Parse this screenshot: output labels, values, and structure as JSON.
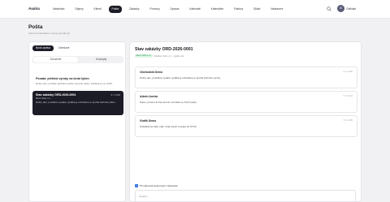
{
  "app": {
    "logo": "Auxira"
  },
  "nav": {
    "items": [
      {
        "label": "Nástěnka",
        "active": false
      },
      {
        "label": "Objevy",
        "active": false
      },
      {
        "label": "Klienti",
        "active": false
      },
      {
        "label": "Pošta",
        "active": true
      },
      {
        "label": "Zákazky",
        "active": false
      },
      {
        "label": "Pomocy",
        "active": false
      },
      {
        "label": "Úprava",
        "active": false
      },
      {
        "label": "Kalendář",
        "active": false
      },
      {
        "label": "Kalendáře",
        "active": false
      },
      {
        "label": "Faktury",
        "active": false
      },
      {
        "label": "Sklad",
        "active": false
      },
      {
        "label": "Nastavení",
        "active": false
      }
    ],
    "user_initials": "O",
    "user_name": "Odhlásit"
  },
  "page": {
    "title": "Pošta",
    "subtitle": "Interní komunikace a týmy pro klienty"
  },
  "left_panel": {
    "new_button": "Nová zpráva",
    "secondary_button": "Odeslané",
    "segments": [
      {
        "label": "Doručené",
        "active": true
      },
      {
        "label": "Koncepty",
        "active": false
      }
    ],
    "threads": [
      {
        "title": "Porada: přehled výroby na tento týden",
        "text": "Dobrý den, posílám přehled výroby na tento týden, začátek je ve 14:00.",
        "meta": "",
        "time": "",
        "selected": false
      },
      {
        "title": "Stav zakázky ORD-2026-0001",
        "meta": "Klient: Nefin s.r.o.",
        "text": "Dobrý den, posíláme update: grafika je schválena a výroba běží dle plánu.",
        "time": "8. 3. 10:00",
        "selected": true
      }
    ]
  },
  "right_panel": {
    "title": "Stav zakázky ORD-2026-0001",
    "chip": "Klient: Nefin s.r.o.",
    "meta": "Zakázka: Nefin s.r.o. – grafika, tisk",
    "messages": [
      {
        "author": "Obchodník Demo",
        "text": "Dobrý den, posíláme update: grafika je schválena a výroba běží dle výroby.",
        "time": "8. 3. 10:00"
      },
      {
        "author": "Admin Auxira",
        "text": "Super, prosím & time termín montáže ve zbozí tyden.",
        "time": "8. 3. 10:14"
      },
      {
        "author": "Grafik Demo",
        "text": "Podklady ke tisku nahr. final export a kopie do 15:00.",
        "time": "8. 3. 11:05"
      }
    ],
    "composer_check": "Při odpovědi poslat kopii i zadavateli",
    "composer_placeholder": "Napište..."
  },
  "colors": {
    "accent_dark": "#1c1c26",
    "chip_green": "#1f8a45",
    "checkbox_blue": "#2f6de1"
  }
}
